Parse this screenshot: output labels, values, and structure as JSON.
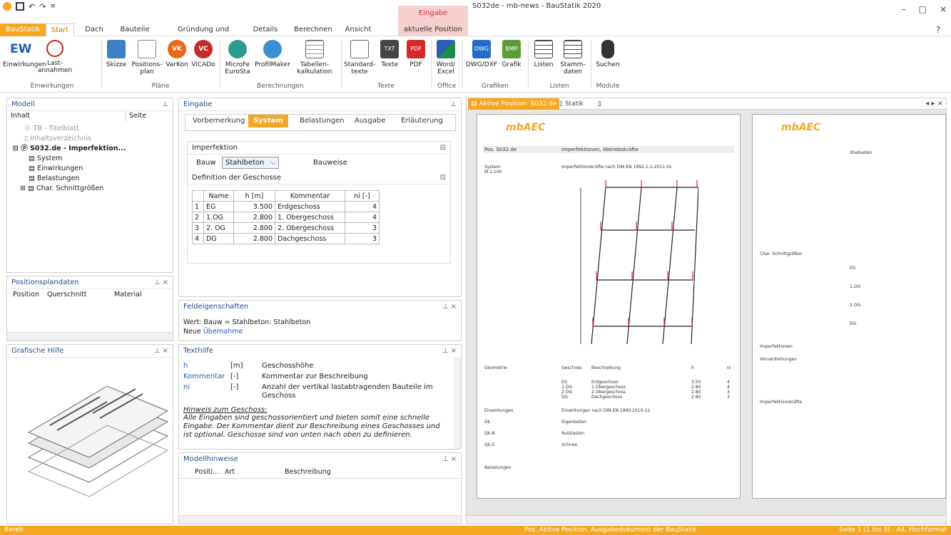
{
  "window": {
    "title": "S032de - mb-news - BauStatik 2020",
    "context_header": "Eingabe",
    "context_tab": "aktuelle Position",
    "min": "–",
    "max": "□",
    "close": "×",
    "help": "?"
  },
  "tabs": [
    "BauStatik",
    "Start",
    "Dach",
    "Bauteile",
    "Gründung und Grundbau",
    "Details",
    "Berechnen",
    "Ansicht"
  ],
  "ribbon": {
    "buttons": [
      {
        "label": "Einwirkungen",
        "icon": "EW"
      },
      {
        "label": "Last-\nannahmen",
        "icon": "load-icon"
      },
      {
        "label": "Skizze",
        "icon": "sketch-icon"
      },
      {
        "label": "Positions-\nplan",
        "icon": "position-plan-icon"
      },
      {
        "label": "VarKon",
        "icon": "VK"
      },
      {
        "label": "ViCADo",
        "icon": "VC"
      },
      {
        "label": "MicroFe\nEuroSta",
        "icon": "microfe-icon"
      },
      {
        "label": "ProfilMaker",
        "icon": "profilmaker-icon"
      },
      {
        "label": "Tabellen-\nkalkulation",
        "icon": "table-icon"
      },
      {
        "label": "Standard-\ntexte",
        "icon": "std-text-icon"
      },
      {
        "label": "Texte",
        "icon": "TXT"
      },
      {
        "label": "PDF",
        "icon": "PDF"
      },
      {
        "label": "Word/\nExcel",
        "icon": "word-icon"
      },
      {
        "label": "DWG/DXF",
        "icon": "DWG"
      },
      {
        "label": "Grafik",
        "icon": "BMP"
      },
      {
        "label": "Listen",
        "icon": "list-icon"
      },
      {
        "label": "Stamm-\ndaten",
        "icon": "master-icon"
      },
      {
        "label": "Suchen",
        "icon": "binoculars-icon"
      }
    ],
    "groups": [
      "Einwirkungen",
      "Pläne",
      "Berechnungen",
      "Texte",
      "Office",
      "Grafiken",
      "Listen",
      "Module"
    ]
  },
  "modell": {
    "title": "Modell",
    "col_inhalt": "Inhalt",
    "col_seite": "Seite",
    "items": [
      "TB - Titelblatt",
      "Inhaltsverzeichnis",
      "S032.de - Imperfektion...",
      "System",
      "Einwirkungen",
      "Belastungen",
      "Char. Schnittgrößen"
    ]
  },
  "posplan": {
    "title": "Positionsplandaten",
    "cols": [
      "Position",
      "Querschnitt",
      "Material"
    ]
  },
  "grafik": {
    "title": "Grafische Hilfe"
  },
  "eingabe": {
    "title": "Eingabe",
    "tabs": [
      "Vorbemerkung",
      "System",
      "Belastungen",
      "Ausgabe",
      "Erläuterung"
    ],
    "imperfektion": "Imperfektion",
    "bauw_label": "Bauw",
    "bauw_value": "Stahlbeton",
    "bauweise": "Bauweise",
    "def_title": "Definition der Geschosse",
    "cols": [
      "Name",
      "h [m]",
      "Kommentar",
      "ni [-]"
    ],
    "rows": [
      [
        "1",
        "EG",
        "3.500",
        "Erdgeschoss",
        "4"
      ],
      [
        "2",
        "1.OG",
        "2.800",
        "1. Obergeschoss",
        "4"
      ],
      [
        "3",
        "2. OG",
        "2.800",
        "2. Obergeschoss",
        "3"
      ],
      [
        "4",
        "DG",
        "2.800",
        "Dachgeschoss",
        "3"
      ]
    ]
  },
  "feld": {
    "title": "Feldeigenschaften",
    "line1": "Wert: Bauw = Stahlbeton: Stahlbeton",
    "line2a": "Neue ",
    "line2b": "Übernahme"
  },
  "texthilfe": {
    "title": "Texthilfe",
    "rows": [
      [
        "h",
        "[m]",
        "Geschosshöhe"
      ],
      [
        "Kommentar",
        "[-]",
        "Kommentar zur Beschreibung"
      ],
      [
        "ni",
        "[-]",
        "Anzahl der vertikal lastabtragenden Bauteile im Geschoss"
      ]
    ],
    "hint_title": "Hinweis zum Geschoss:",
    "hint": "Alle Eingaben sind geschossorientiert und bieten somit eine schnelle Eingabe. Der Kommentar dient zur Beschreibung eines Geschosses und ist optional. Geschosse sind von unten nach oben zu definieren."
  },
  "modellhinweise": {
    "title": "Modellhinweise",
    "cols": [
      "Positi...",
      "Art",
      "Beschreibung"
    ]
  },
  "doc": {
    "tab_active": "Aktive Position: S032.de",
    "tab_statik": "Statik",
    "pos": "Pos. S032.de",
    "pos_title": "Imperfektionen, Abtriebskräfte",
    "system": "System",
    "scale": "M 1:100",
    "system_desc": "Imperfektionskräfte nach DIN EN 1992-1-1:2011-01",
    "geometrie": "Geometrie",
    "einwirkungen": "Einwirkungen",
    "einw_desc": "Einwirkungen nach DIN EN 1990:2010-12",
    "belastungen": "Belastungen",
    "geo_cols": [
      "Geschoss",
      "Beschreibung",
      "h",
      "ni"
    ],
    "geo_rows": [
      [
        "EG",
        "Erdgeschoss",
        "3.50",
        "4"
      ],
      [
        "1.OG",
        "1.Obergeschoss",
        "2.80",
        "4"
      ],
      [
        "2.OG",
        "2.Obergeschoss",
        "2.80",
        "3"
      ],
      [
        "DG",
        "Dachgeschoss",
        "2.80",
        "3"
      ]
    ],
    "loads": [
      [
        "Gk",
        "Eigenlasten"
      ],
      [
        "Qk.N",
        "Nutzlasten"
      ],
      [
        "Qk.S",
        "Schnee"
      ]
    ],
    "stiel": "Stiellasten",
    "char": "Char. Schnittgrößen",
    "imperf": "Imperfektionen",
    "vorverdr": "Vorverdrehungen",
    "imperfkr": "Imperfektionskräfte",
    "storeys": [
      "EG",
      "1.OG",
      "2.OG",
      "DG"
    ]
  },
  "status": {
    "left": "Bereit",
    "mid": "Pos. Aktive Position. Ausgabedokument der BauStatik",
    "right": "Seite 1 (1 bis 3) - A4, Hochformat"
  },
  "colors": {
    "accent": "#f5a623",
    "link": "#1f4e8a",
    "load": "#e02020"
  }
}
